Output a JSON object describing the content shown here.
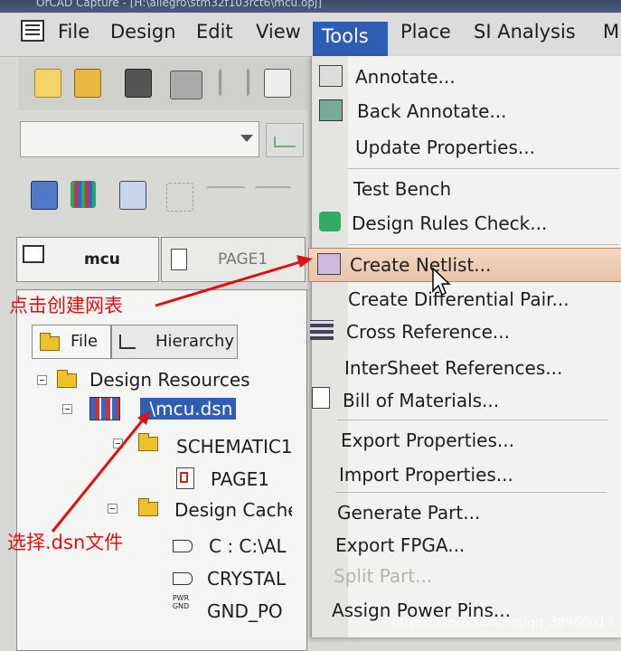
{
  "window": {
    "title": "OrCAD Capture - [H:\\allegro\\stm32f103rct6\\mcu.opj]"
  },
  "menubar": {
    "items": [
      "File",
      "Design",
      "Edit",
      "View",
      "Tools",
      "Place",
      "SI Analysis",
      "M"
    ],
    "active": "Tools"
  },
  "doc_tabs": {
    "tab1": "mcu",
    "tab2": "PAGE1"
  },
  "project_panel": {
    "tab_file": "File",
    "tab_hierarchy": "Hierarchy",
    "tree": {
      "design_resources": "Design Resources",
      "dsn_file": ".\\mcu.dsn",
      "schematic": "SCHEMATIC1",
      "page1": "PAGE1",
      "design_cache": "Design Cache",
      "cache_item_1": "C : C:\\AL",
      "cache_item_2": "CRYSTAL",
      "cache_item_3": "GND_PO"
    },
    "pwr_icon_text": "PWR GND"
  },
  "tools_menu": {
    "items": [
      "Annotate...",
      "Back Annotate...",
      "Update Properties...",
      "Test Bench",
      "Design Rules Check...",
      "Create Netlist...",
      "Create Differential Pair...",
      "Cross Reference...",
      "InterSheet References...",
      "Bill of Materials...",
      "Export Properties...",
      "Import Properties...",
      "Generate Part...",
      "Export FPGA...",
      "Split Part...",
      "Assign Power Pins..."
    ],
    "highlighted": "Create Netlist...",
    "disabled": "Split Part..."
  },
  "annotations": {
    "create_netlist_note": "点击创建网表",
    "select_dsn_note": "选择.dsn文件",
    "arrow_color": "#e01010"
  },
  "watermark": "https://blog.csdn.net/qq_38960013",
  "colors": {
    "menu_active": "#2f5db3",
    "highlight": "#e9c3a8",
    "annotation": "#e01010"
  }
}
